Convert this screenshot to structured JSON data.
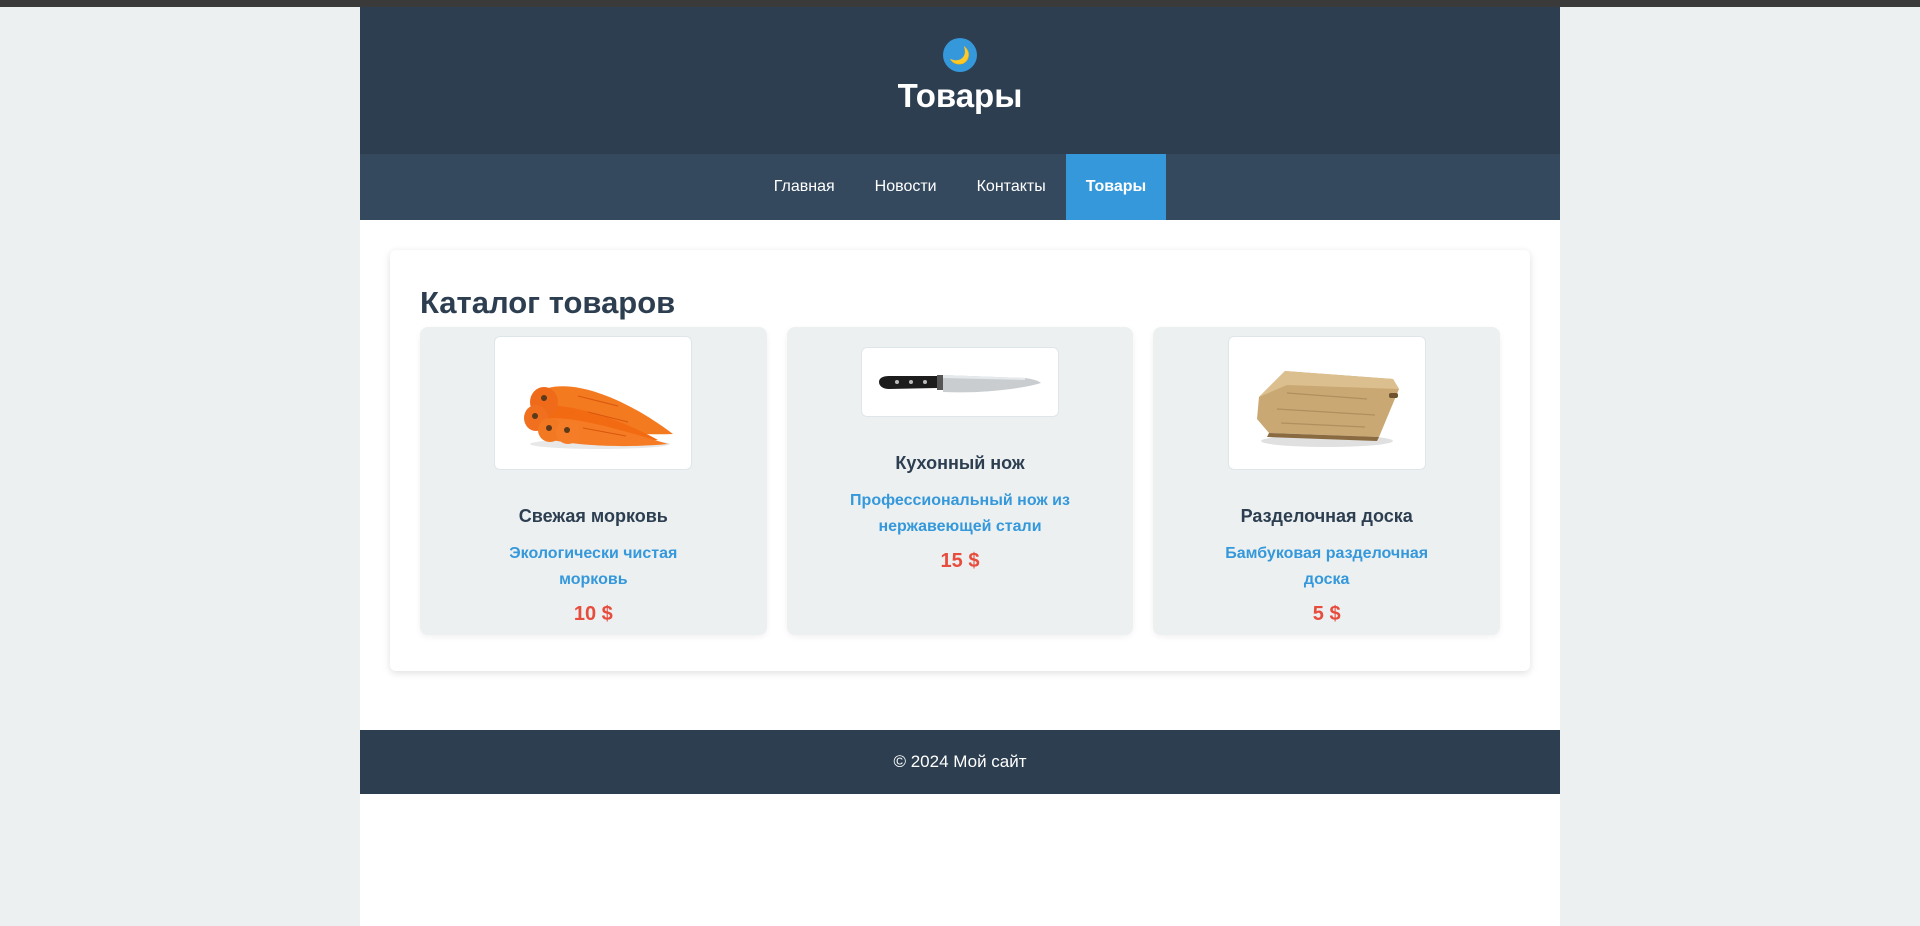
{
  "header": {
    "theme_icon": "moon-icon",
    "theme_glyph": "🌙",
    "title": "Товары"
  },
  "nav": {
    "items": [
      {
        "label": "Главная",
        "active": false
      },
      {
        "label": "Новости",
        "active": false
      },
      {
        "label": "Контакты",
        "active": false
      },
      {
        "label": "Товары",
        "active": true
      }
    ]
  },
  "catalog": {
    "title": "Каталог товаров",
    "products": [
      {
        "name": "Свежая морковь",
        "description": "Экологически чистая морковь",
        "price": "10 $",
        "image": "carrot-image"
      },
      {
        "name": "Кухонный нож",
        "description": "Профессиональный нож из нержавеющей стали",
        "price": "15 $",
        "image": "knife-image"
      },
      {
        "name": "Разделочная доска",
        "description": "Бамбуковая разделочная доска",
        "price": "5 $",
        "image": "cutting-board-image"
      }
    ]
  },
  "footer": {
    "text": "© 2024 Мой сайт"
  },
  "colors": {
    "header_bg": "#2c3e50",
    "nav_bg": "#34495e",
    "accent": "#3498db",
    "price": "#e74c3c",
    "card_bg": "#ecf0f1"
  }
}
